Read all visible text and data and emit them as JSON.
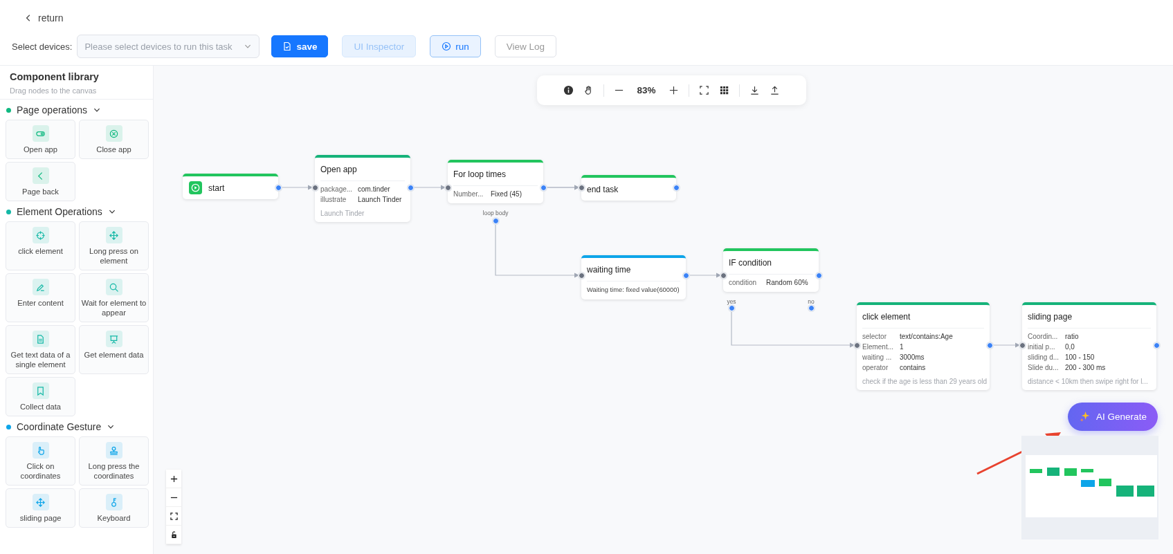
{
  "header": {
    "back_label": "return",
    "device_label": "Select devices:",
    "device_placeholder": "Please select devices to run this task",
    "buttons": [
      {
        "label": "save",
        "kind": "primary"
      },
      {
        "label": "UI Inspector",
        "kind": "disabled"
      },
      {
        "label": "run",
        "kind": "outline"
      },
      {
        "label": "View Log",
        "kind": "plain"
      }
    ]
  },
  "sidebar": {
    "title": "Component library",
    "subtitle": "Drag nodes to the canvas",
    "sections": [
      {
        "title": "Page operations",
        "color": "#10b981",
        "expanded": true,
        "items": [
          {
            "label": "Open app"
          },
          {
            "label": "Close app"
          },
          {
            "label": "Page back"
          }
        ]
      },
      {
        "title": "Element Operations",
        "color": "#14b8a6",
        "expanded": true,
        "items": [
          {
            "label": "click element"
          },
          {
            "label": "Long press on element"
          },
          {
            "label": "Enter content"
          },
          {
            "label": "Wait for element to appear"
          },
          {
            "label": "Get text data of a single element"
          },
          {
            "label": "Get element data"
          },
          {
            "label": "Collect data"
          }
        ]
      },
      {
        "title": "Coordinate Gesture",
        "color": "#0ea5e9",
        "expanded": true,
        "items": [
          {
            "label": "Click on coordinates"
          },
          {
            "label": "Long press the coordinates"
          },
          {
            "label": "sliding page"
          },
          {
            "label": "Keyboard"
          }
        ]
      }
    ]
  },
  "toolbar": {
    "zoom": "83%"
  },
  "nodes": [
    {
      "kind": "start",
      "title": "start",
      "color": "#22c55e"
    },
    {
      "kind": "action",
      "title": "Open app",
      "color": "#16b37a",
      "fields": [
        {
          "label": "package...",
          "value": "com.tinder"
        },
        {
          "label": "illustrate",
          "value": "Launch Tinder"
        }
      ],
      "note": "Launch Tinder"
    },
    {
      "kind": "action",
      "title": "For loop times",
      "color": "#22c55e",
      "fields": [
        {
          "label": "Number...",
          "value": "Fixed (45)"
        }
      ]
    },
    {
      "kind": "action",
      "title": "end task",
      "color": "#22c55e"
    },
    {
      "kind": "action",
      "title": "waiting time",
      "color": "#0ea5e9",
      "text": "Waiting time: fixed value(60000)"
    },
    {
      "kind": "action",
      "title": "IF condition",
      "color": "#22c55e",
      "fields": [
        {
          "label": "condition",
          "value": "Random 60%"
        }
      ]
    },
    {
      "kind": "action",
      "title": "click element",
      "color": "#16b37a",
      "fields": [
        {
          "label": "selector",
          "value": "text/contains:Age"
        },
        {
          "label": "Element...",
          "value": "1"
        },
        {
          "label": "waiting ...",
          "value": "3000ms"
        },
        {
          "label": "operator",
          "value": "contains"
        }
      ],
      "note": "check if the age is less than 29 years old"
    },
    {
      "kind": "action",
      "title": "sliding page",
      "color": "#16b37a",
      "fields": [
        {
          "label": "Coordin...",
          "value": "ratio"
        },
        {
          "label": "initial p...",
          "value": "0,0"
        },
        {
          "label": "sliding d...",
          "value": "100 - 150"
        },
        {
          "label": "Slide du...",
          "value": "200 - 300 ms"
        }
      ],
      "note": "distance < 10km then swipe right for l..."
    }
  ],
  "port_labels": [
    "loop body",
    "yes",
    "no"
  ],
  "ai_button": {
    "label": "AI Generate"
  }
}
